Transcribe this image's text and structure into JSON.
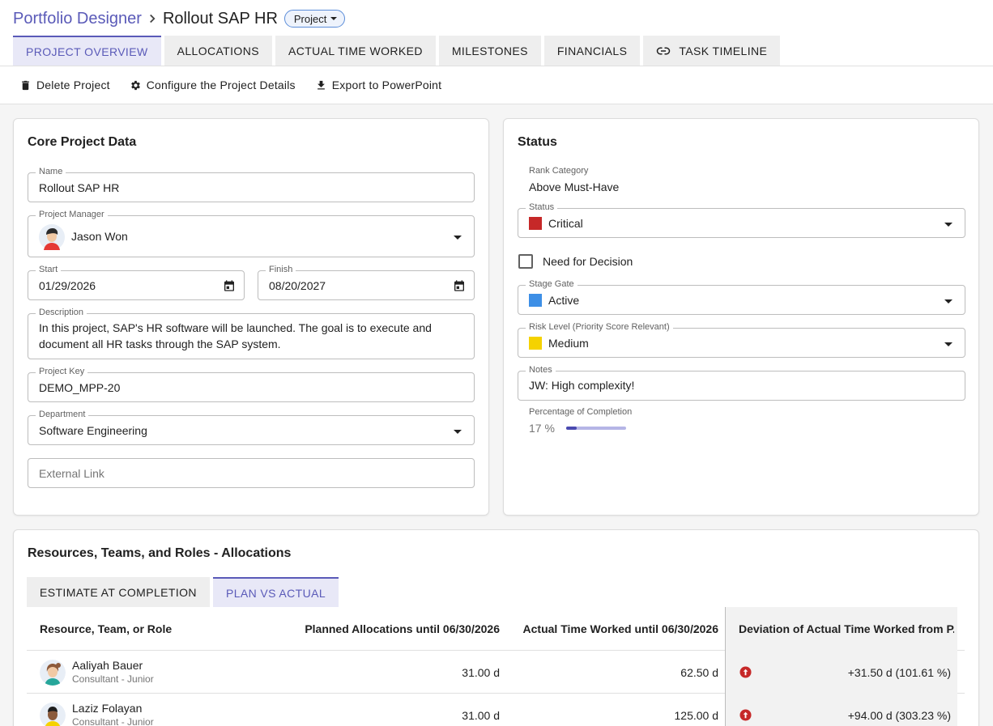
{
  "header": {
    "app_name": "Portfolio Designer",
    "project_name": "Rollout SAP HR",
    "type_chip": "Project"
  },
  "tabs": [
    {
      "label": "PROJECT OVERVIEW",
      "active": true
    },
    {
      "label": "ALLOCATIONS"
    },
    {
      "label": "ACTUAL TIME WORKED"
    },
    {
      "label": "MILESTONES"
    },
    {
      "label": "FINANCIALS"
    },
    {
      "label": "TASK TIMELINE",
      "icon": "link-icon"
    }
  ],
  "actions": {
    "delete": "Delete Project",
    "configure": "Configure the Project Details",
    "export": "Export to PowerPoint"
  },
  "core": {
    "title": "Core Project Data",
    "name_label": "Name",
    "name_value": "Rollout SAP HR",
    "pm_label": "Project Manager",
    "pm_value": "Jason Won",
    "start_label": "Start",
    "start_value": "01/29/2026",
    "finish_label": "Finish",
    "finish_value": "08/20/2027",
    "desc_label": "Description",
    "desc_line1": "In this project, SAP's HR software will be launched. The goal is to execute and",
    "desc_line2": "document all HR tasks through the SAP system.",
    "key_label": "Project Key",
    "key_value": "DEMO_MPP-20",
    "dept_label": "Department",
    "dept_value": "Software Engineering",
    "link_placeholder": "External Link"
  },
  "status": {
    "title": "Status",
    "rank_label": "Rank Category",
    "rank_value": "Above Must-Have",
    "status_label": "Status",
    "status_value": "Critical",
    "status_color": "#c62828",
    "decision_label": "Need for Decision",
    "decision_checked": false,
    "stage_label": "Stage Gate",
    "stage_value": "Active",
    "stage_color": "#3d8fe6",
    "risk_label": "Risk Level (Priority Score Relevant)",
    "risk_value": "Medium",
    "risk_color": "#f5d200",
    "notes_label": "Notes",
    "notes_value": "JW: High complexity!",
    "completion_label": "Percentage of Completion",
    "completion_text": "17 %",
    "completion_fraction": 0.17
  },
  "allocations": {
    "title": "Resources, Teams, and Roles - Allocations",
    "subtabs": [
      {
        "label": "ESTIMATE AT COMPLETION"
      },
      {
        "label": "PLAN VS ACTUAL",
        "active": true
      }
    ],
    "columns": [
      "Resource, Team, or Role",
      "Planned Allocations until 06/30/2026",
      "Actual Time Worked until 06/30/2026",
      "Deviation of Actual Time Worked from P..."
    ],
    "rows": [
      {
        "name": "Aaliyah Bauer",
        "role": "Consultant - Junior",
        "planned": "31.00 d",
        "actual": "62.50 d",
        "deviation": "+31.50 d (101.61 %)"
      },
      {
        "name": "Laziz Folayan",
        "role": "Consultant - Junior",
        "planned": "31.00 d",
        "actual": "125.00 d",
        "deviation": "+94.00 d (303.23 %)"
      }
    ]
  }
}
